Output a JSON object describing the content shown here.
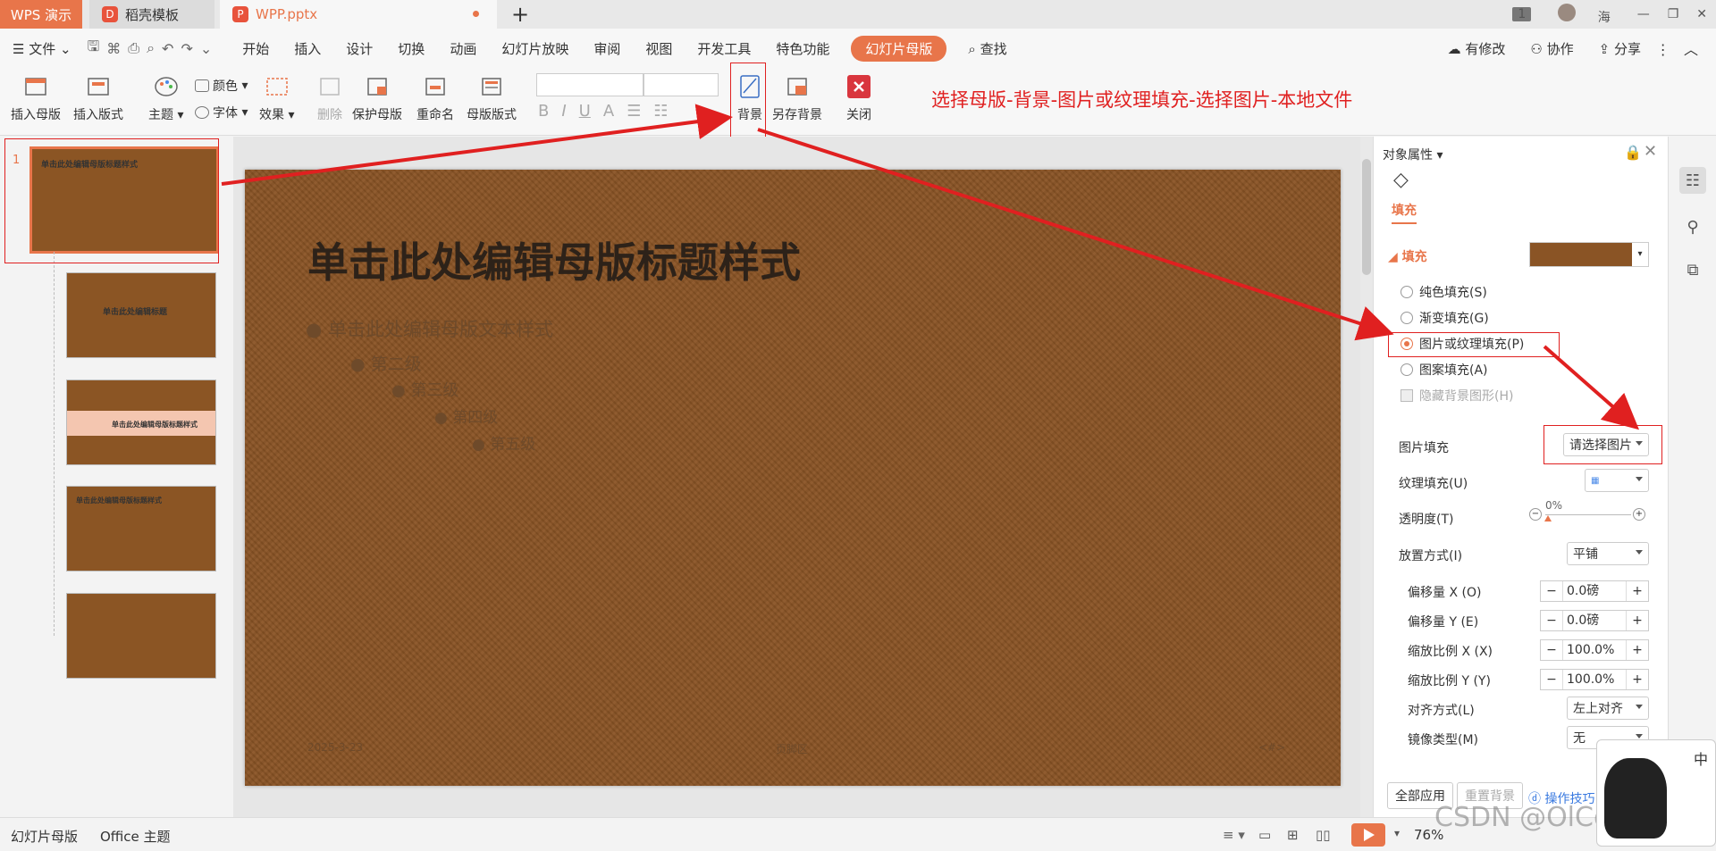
{
  "titlebar": {
    "app_badge": "WPS 演示",
    "tab1": "稻壳模板",
    "tab2": "WPP.pptx",
    "new_tab": "+",
    "page_count": "1",
    "user": "海",
    "min": "—",
    "restore": "❐",
    "close": "✕"
  },
  "menubar": {
    "file": "文件",
    "items": [
      "开始",
      "插入",
      "设计",
      "切换",
      "动画",
      "幻灯片放映",
      "审阅",
      "视图",
      "开发工具",
      "特色功能"
    ],
    "active": "幻灯片母版",
    "search": "查找",
    "right": [
      "有修改",
      "协作",
      "分享"
    ]
  },
  "ribbon": {
    "insert_master": "插入母版",
    "insert_layout": "插入版式",
    "theme": "主题",
    "color": "颜色",
    "font": "字体",
    "effect": "效果",
    "delete": "删除",
    "protect": "保护母版",
    "rename": "重命名",
    "master_layout": "母版版式",
    "background": "背景",
    "save_background": "另存背景",
    "close": "关闭"
  },
  "annotation": "选择母版-背景-图片或纹理填充-选择图片-本地文件",
  "thumbs": {
    "number": "1",
    "titles": [
      "单击此处编辑母版标题样式",
      "单击此处编辑标题",
      "单击此处编辑母版标题样式",
      "单击此处编辑母版标题样式",
      ""
    ]
  },
  "slide": {
    "title": "单击此处编辑母版标题样式",
    "bullets": [
      "单击此处编辑母版文本样式",
      "第二级",
      "第三级",
      "第四级",
      "第五级"
    ],
    "date": "2025-3-23",
    "footer": "页脚区",
    "page": "<#>"
  },
  "panel": {
    "header": "对象属性",
    "fill_tab": "填充",
    "fill_section": "填充",
    "options": [
      "纯色填充(S)",
      "渐变填充(G)",
      "图片或纹理填充(P)",
      "图案填充(A)",
      "隐藏背景图形(H)"
    ],
    "picture_fill_label": "图片填充",
    "picture_fill_value": "请选择图片",
    "texture_fill_label": "纹理填充(U)",
    "transparency_label": "透明度(T)",
    "transparency_value": "0%",
    "placement_label": "放置方式(I)",
    "placement_value": "平铺",
    "offset_x_label": "偏移量 X (O)",
    "offset_x": "0.0磅",
    "offset_y_label": "偏移量 Y (E)",
    "offset_y": "0.0磅",
    "scale_x_label": "缩放比例 X (X)",
    "scale_x": "100.0%",
    "scale_y_label": "缩放比例 Y (Y)",
    "scale_y": "100.0%",
    "align_label": "对齐方式(L)",
    "align_value": "左上对齐",
    "mirror_label": "镜像类型(M)",
    "mirror_value": "无",
    "apply_all": "全部应用",
    "reset": "重置背景",
    "tips": "操作技巧"
  },
  "statusbar": {
    "mode": "幻灯片母版",
    "theme": "Office 主题",
    "zoom": "76%"
  },
  "watermark": "CSDN @OlCorreo",
  "colors": {
    "accent": "#e8754a",
    "leather": "#8a5425",
    "annotation": "#e02020"
  }
}
